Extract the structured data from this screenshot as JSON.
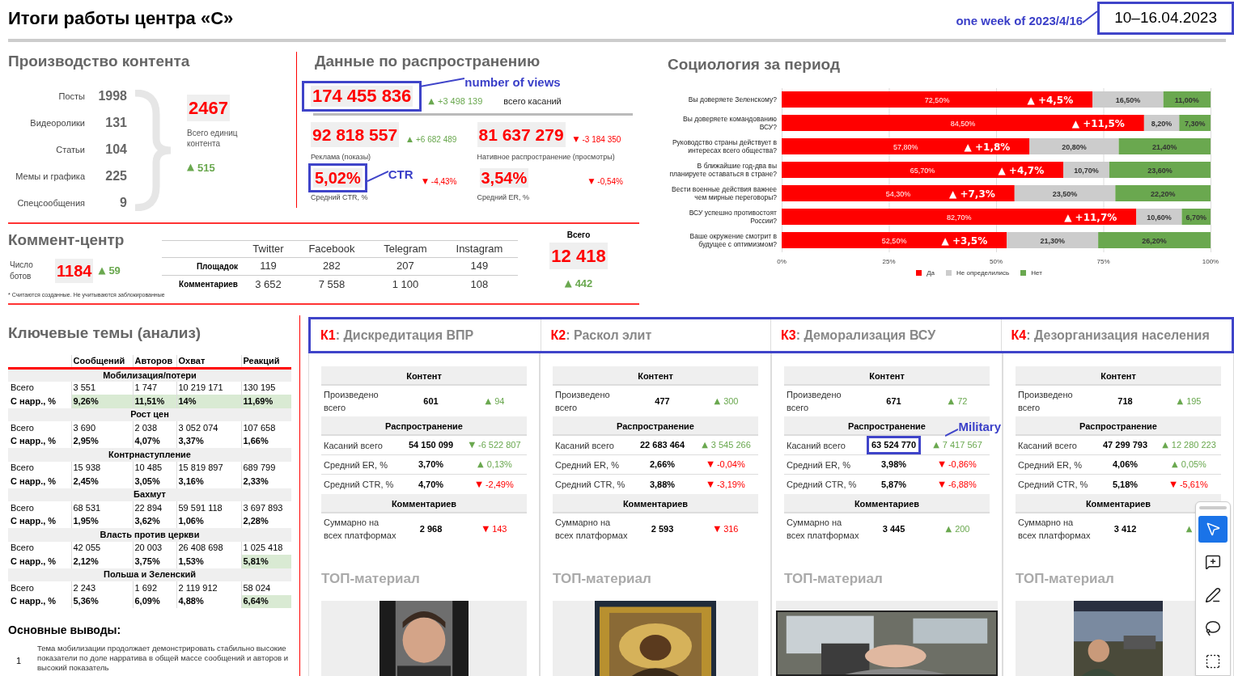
{
  "header": {
    "title": "Итоги работы центра «С»",
    "date_note": "one week of 2023/4/16",
    "date": "10–16.04.2023"
  },
  "production": {
    "title": "Производство контента",
    "items": [
      {
        "label": "Посты",
        "value": "1998"
      },
      {
        "label": "Видеоролики",
        "value": "131"
      },
      {
        "label": "Статьи",
        "value": "104"
      },
      {
        "label": "Мемы и графика",
        "value": "225"
      },
      {
        "label": "Спецсообщения",
        "value": "9"
      }
    ],
    "total": "2467",
    "total_label": "Всего единиц контента",
    "delta": {
      "arrow": "▲",
      "color": "#6aa84f",
      "text": "515"
    }
  },
  "distribution": {
    "title": "Данные по распространению",
    "total": {
      "value": "174 455 836",
      "boxed": true,
      "note": "number of views",
      "delta": {
        "arrow": "▲",
        "color": "#6aa84f",
        "text": "+3 498 139"
      },
      "label": "всего касаний"
    },
    "channels": [
      {
        "value": "92 818 557",
        "delta": {
          "arrow": "▲",
          "color": "#6aa84f",
          "text": "+6 682 489"
        },
        "label": "Реклама (показы)",
        "metric": {
          "value": "5,02%",
          "boxed": true,
          "note": "CTR",
          "delta": {
            "arrow": "▼",
            "color": "#ff0000",
            "text": "-4,43%"
          },
          "label": "Средний CTR, %"
        }
      },
      {
        "value": "81 637 279",
        "delta": {
          "arrow": "▼",
          "color": "#ff0000",
          "text": "-3 184 350"
        },
        "label": "Нативное распространение (просмотры)",
        "metric": {
          "value": "3,54%",
          "delta": {
            "arrow": "▼",
            "color": "#ff0000",
            "text": "-0,54%"
          },
          "label": "Средний ER, %"
        }
      }
    ]
  },
  "comment_center": {
    "title": "Коммент-центр",
    "bots_label": "Число ботов",
    "bots": "1184",
    "bots_delta": {
      "arrow": "▲",
      "color": "#6aa84f",
      "text": "59"
    },
    "columns": [
      "Twitter",
      "Facebook",
      "Telegram",
      "Instagram"
    ],
    "rows": [
      {
        "label": "Площадок",
        "values": [
          "119",
          "282",
          "207",
          "149"
        ]
      },
      {
        "label": "Комментариев",
        "values": [
          "3 652",
          "7 558",
          "1 100",
          "108"
        ]
      }
    ],
    "total_label": "Всего",
    "total": "12 418",
    "total_delta": {
      "arrow": "▲",
      "color": "#6aa84f",
      "text": "442"
    },
    "footnote": "* Считаются созданные. Не учитываются заблокированные"
  },
  "sociology": {
    "title": "Социология за период",
    "chart_data": {
      "type": "bar",
      "orientation": "horizontal",
      "stacked": true,
      "categories": [
        "Вы доверяете Зеленскому?",
        "Вы доверяете командованию ВСУ?",
        "Руководство страны действует в интересах всего общества?",
        "В ближайшие год-два вы планируете оставаться в стране?",
        "Вести военные действия важнее чем мирные переговоры?",
        "ВСУ успешно противостоят России?",
        "Ваше окружение смотрит в будущее с оптимизмом?"
      ],
      "series": [
        {
          "name": "Да",
          "color": "#ff0000",
          "values": [
            72.5,
            84.5,
            57.8,
            65.7,
            54.3,
            82.7,
            52.5
          ],
          "value_labels": [
            "72,50%",
            "84,50%",
            "57,80%",
            "65,70%",
            "54,30%",
            "82,70%",
            "52,50%"
          ]
        },
        {
          "name": "Не определились",
          "color": "#cccccc",
          "values": [
            16.5,
            8.2,
            20.8,
            10.7,
            23.5,
            10.6,
            21.3
          ],
          "value_labels": [
            "16,50%",
            "8,20%",
            "20,80%",
            "10,70%",
            "23,50%",
            "10,60%",
            "21,30%"
          ]
        },
        {
          "name": "Нет",
          "color": "#6aa84f",
          "values": [
            11,
            7.3,
            21.4,
            23.6,
            22.2,
            6.7,
            26.2
          ],
          "value_labels": [
            "11,00%",
            "7,30%",
            "21,40%",
            "23,60%",
            "22,20%",
            "6,70%",
            "26,20%"
          ]
        }
      ],
      "xlim": [
        0,
        100
      ],
      "xticks": [
        {
          "value": 0,
          "label": "0%"
        },
        {
          "value": 25,
          "label": "25%"
        },
        {
          "value": 50,
          "label": "50%"
        },
        {
          "value": 75,
          "label": "75%"
        },
        {
          "value": 100,
          "label": "100%"
        }
      ],
      "grid": true,
      "legend": "bottom",
      "annotations": [
        {
          "text": "▲ +4,5%"
        },
        {
          "text": "▲ +11,5%"
        },
        {
          "text": "▲ +1,8%"
        },
        {
          "text": "▲ +4,7%"
        },
        {
          "text": "▲ +7,3%"
        },
        {
          "text": "▲ +11,7%"
        },
        {
          "text": "▲ +3,5%"
        }
      ]
    }
  },
  "key_themes": {
    "title": "Ключевые темы (анализ)",
    "columns": [
      "Сообщений",
      "Авторов",
      "Охват",
      "Реакций"
    ],
    "groups": [
      {
        "title": "Мобилизация/потери",
        "rows": [
          {
            "label": "Всего",
            "cells": [
              {
                "text": "3 551",
                "highlight": false
              },
              {
                "text": "1 747",
                "highlight": false
              },
              {
                "text": "10 219 171",
                "highlight": false
              },
              {
                "text": "130 195",
                "highlight": false
              }
            ]
          },
          {
            "label": "С нарр., %",
            "cells": [
              {
                "text": "9,26%",
                "highlight": true
              },
              {
                "text": "11,51%",
                "highlight": true
              },
              {
                "text": "14%",
                "highlight": true
              },
              {
                "text": "11,69%",
                "highlight": true
              }
            ]
          }
        ]
      },
      {
        "title": "Рост цен",
        "rows": [
          {
            "label": "Всего",
            "cells": [
              {
                "text": "3 690",
                "highlight": false
              },
              {
                "text": "2 038",
                "highlight": false
              },
              {
                "text": "3 052 074",
                "highlight": false
              },
              {
                "text": "107 658",
                "highlight": false
              }
            ]
          },
          {
            "label": "С нарр., %",
            "cells": [
              {
                "text": "2,95%",
                "highlight": false
              },
              {
                "text": "4,07%",
                "highlight": false
              },
              {
                "text": "3,37%",
                "highlight": false
              },
              {
                "text": "1,66%",
                "highlight": false
              }
            ]
          }
        ]
      },
      {
        "title": "Контрнаступление",
        "rows": [
          {
            "label": "Всего",
            "cells": [
              {
                "text": "15 938",
                "highlight": false
              },
              {
                "text": "10 485",
                "highlight": false
              },
              {
                "text": "15 819 897",
                "highlight": false
              },
              {
                "text": "689 799",
                "highlight": false
              }
            ]
          },
          {
            "label": "С нарр., %",
            "cells": [
              {
                "text": "2,45%",
                "highlight": false
              },
              {
                "text": "3,05%",
                "highlight": false
              },
              {
                "text": "3,16%",
                "highlight": false
              },
              {
                "text": "2,33%",
                "highlight": false
              }
            ]
          }
        ]
      },
      {
        "title": "Бахмут",
        "rows": [
          {
            "label": "Всего",
            "cells": [
              {
                "text": "68 531",
                "highlight": false
              },
              {
                "text": "22 894",
                "highlight": false
              },
              {
                "text": "59 591 118",
                "highlight": false
              },
              {
                "text": "3 697 893",
                "highlight": false
              }
            ]
          },
          {
            "label": "С нарр., %",
            "cells": [
              {
                "text": "1,95%",
                "highlight": false
              },
              {
                "text": "3,62%",
                "highlight": false
              },
              {
                "text": "1,06%",
                "highlight": false
              },
              {
                "text": "2,28%",
                "highlight": false
              }
            ]
          }
        ]
      },
      {
        "title": "Власть против церкви",
        "rows": [
          {
            "label": "Всего",
            "cells": [
              {
                "text": "42 055",
                "highlight": false
              },
              {
                "text": "20 003",
                "highlight": false
              },
              {
                "text": "26 408 698",
                "highlight": false
              },
              {
                "text": "1 025 418",
                "highlight": false
              }
            ]
          },
          {
            "label": "С нарр., %",
            "cells": [
              {
                "text": "2,12%",
                "highlight": false
              },
              {
                "text": "3,75%",
                "highlight": false
              },
              {
                "text": "1,53%",
                "highlight": false
              },
              {
                "text": "5,81%",
                "highlight": true
              }
            ]
          }
        ]
      },
      {
        "title": "Польша и Зеленский",
        "rows": [
          {
            "label": "Всего",
            "cells": [
              {
                "text": "2 243",
                "highlight": false
              },
              {
                "text": "1 692",
                "highlight": false
              },
              {
                "text": "2 119 912",
                "highlight": false
              },
              {
                "text": "58 024",
                "highlight": false
              }
            ]
          },
          {
            "label": "С нарр., %",
            "cells": [
              {
                "text": "5,36%",
                "highlight": false
              },
              {
                "text": "6,09%",
                "highlight": false
              },
              {
                "text": "4,88%",
                "highlight": false
              },
              {
                "text": "6,64%",
                "highlight": true
              }
            ]
          }
        ]
      }
    ]
  },
  "conclusions": {
    "title": "Основные выводы:",
    "items": [
      {
        "number": "1",
        "text": "Тема мобилизации продолжает демонстрировать стабильно высокие показатели по доле нарратива в общей массе сообщений и авторов и высокий показатель"
      }
    ]
  },
  "cards": [
    {
      "code": "К1",
      "title": ": Дискредитация ВПР",
      "sections": [
        {
          "header": "Контент",
          "rows": [
            {
              "label": "Произведено всего",
              "value": "601",
              "delta": {
                "arrow": "▲",
                "color": "#6aa84f",
                "text": "94"
              }
            }
          ]
        },
        {
          "header": "Распространение",
          "rows": [
            {
              "label": "Касаний всего",
              "value": "54 150 099",
              "delta": {
                "arrow": "▼",
                "color": "#6aa84f",
                "text": "-6 522 807"
              }
            },
            {
              "label": "Средний ER, %",
              "value": "3,70%",
              "delta": {
                "arrow": "▲",
                "color": "#6aa84f",
                "text": "0,13%"
              }
            },
            {
              "label": "Средний CTR, %",
              "value": "4,70%",
              "delta": {
                "arrow": "▼",
                "color": "#ff0000",
                "text": "-2,49%"
              }
            }
          ]
        },
        {
          "header": "Комментариев",
          "rows": [
            {
              "label": "Суммарно на всех платформах",
              "value": "2 968",
              "delta": {
                "arrow": "▼",
                "color": "#ff0000",
                "text": "143"
              }
            }
          ]
        }
      ],
      "top_label": "ТОП-материал"
    },
    {
      "code": "К2",
      "title": ": Раскол элит",
      "sections": [
        {
          "header": "Контент",
          "rows": [
            {
              "label": "Произведено всего",
              "value": "477",
              "delta": {
                "arrow": "▲",
                "color": "#6aa84f",
                "text": "300"
              }
            }
          ]
        },
        {
          "header": "Распространение",
          "rows": [
            {
              "label": "Касаний всего",
              "value": "22 683 464",
              "delta": {
                "arrow": "▲",
                "color": "#6aa84f",
                "text": "3 545 266"
              }
            },
            {
              "label": "Средний ER, %",
              "value": "2,66%",
              "delta": {
                "arrow": "▼",
                "color": "#ff0000",
                "text": "-0,04%"
              }
            },
            {
              "label": "Средний CTR, %",
              "value": "3,88%",
              "delta": {
                "arrow": "▼",
                "color": "#ff0000",
                "text": "-3,19%"
              }
            }
          ]
        },
        {
          "header": "Комментариев",
          "rows": [
            {
              "label": "Суммарно на всех платформах",
              "value": "2 593",
              "delta": {
                "arrow": "▼",
                "color": "#ff0000",
                "text": "316"
              }
            }
          ]
        }
      ],
      "top_label": "ТОП-материал"
    },
    {
      "code": "К3",
      "title": ": Деморализация ВСУ",
      "sections": [
        {
          "header": "Контент",
          "rows": [
            {
              "label": "Произведено всего",
              "value": "671",
              "delta": {
                "arrow": "▲",
                "color": "#6aa84f",
                "text": "72"
              }
            }
          ]
        },
        {
          "header": "Распространение",
          "rows": [
            {
              "label": "Касаний всего",
              "value": "63 524 770",
              "boxed": true,
              "note": "Military",
              "delta": {
                "arrow": "▲",
                "color": "#6aa84f",
                "text": "7 417 567"
              }
            },
            {
              "label": "Средний ER, %",
              "value": "3,98%",
              "delta": {
                "arrow": "▼",
                "color": "#ff0000",
                "text": "-0,86%"
              }
            },
            {
              "label": "Средний CTR, %",
              "value": "5,87%",
              "delta": {
                "arrow": "▼",
                "color": "#ff0000",
                "text": "-6,88%"
              }
            }
          ]
        },
        {
          "header": "Комментариев",
          "rows": [
            {
              "label": "Суммарно на всех платформах",
              "value": "3 445",
              "delta": {
                "arrow": "▲",
                "color": "#6aa84f",
                "text": "200"
              }
            }
          ]
        }
      ],
      "top_label": "ТОП-материал"
    },
    {
      "code": "К4",
      "title": ": Дезорганизация населения",
      "sections": [
        {
          "header": "Контент",
          "rows": [
            {
              "label": "Произведено всего",
              "value": "718",
              "delta": {
                "arrow": "▲",
                "color": "#6aa84f",
                "text": "195"
              }
            }
          ]
        },
        {
          "header": "Распространение",
          "rows": [
            {
              "label": "Касаний всего",
              "value": "47 299 793",
              "delta": {
                "arrow": "▲",
                "color": "#6aa84f",
                "text": "12 280 223"
              }
            },
            {
              "label": "Средний ER, %",
              "value": "4,06%",
              "delta": {
                "arrow": "▲",
                "color": "#6aa84f",
                "text": "0,05%"
              }
            },
            {
              "label": "Средний CTR, %",
              "value": "5,18%",
              "delta": {
                "arrow": "▼",
                "color": "#ff0000",
                "text": "-5,61%"
              }
            }
          ]
        },
        {
          "header": "Комментариев",
          "rows": [
            {
              "label": "Суммарно на всех платформах",
              "value": "3 412",
              "delta": {
                "arrow": "▲",
                "color": "#6aa84f"
              }
            }
          ]
        }
      ],
      "top_label": "ТОП-материал"
    }
  ],
  "toolbar": {
    "tools": [
      {
        "kind": "pointer",
        "selected": true
      },
      {
        "kind": "comment",
        "selected": false
      },
      {
        "kind": "pen",
        "selected": false
      },
      {
        "kind": "lasso",
        "selected": false
      },
      {
        "kind": "textbox",
        "selected": false
      }
    ]
  }
}
